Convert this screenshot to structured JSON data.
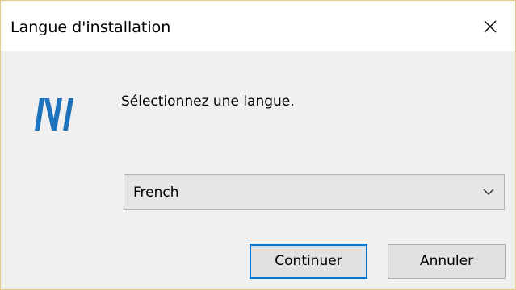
{
  "window": {
    "title": "Langue d'installation",
    "close_symbol": "×"
  },
  "logo": {
    "icon": "installer-logo-icon",
    "color": "#1e73be"
  },
  "dialog": {
    "prompt": "Sélectionnez une langue.",
    "language_select": {
      "value": "French"
    },
    "buttons": {
      "continue_label": "Continuer",
      "cancel_label": "Annuler"
    }
  },
  "colors": {
    "accent_border": "#0078d7",
    "window_border": "#e9c98b"
  }
}
